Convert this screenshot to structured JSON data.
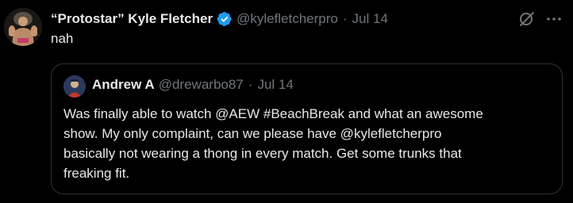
{
  "author": {
    "name": "“Protostar” Kyle Fletcher",
    "handle": "@kylefletcherpro",
    "date": "Jul 14",
    "verified": true
  },
  "separator": "·",
  "tweet": {
    "text": "nah"
  },
  "quote": {
    "name": "Andrew A",
    "handle": "@drewarbo87",
    "date": "Jul 14",
    "lines": [
      "Was finally able to watch @AEW #BeachBreak and what an awesome",
      "show. My only complaint, can we please have @kylefletcherpro",
      "basically not wearing a thong in every match. Get some trunks that",
      "freaking fit."
    ]
  },
  "icons": {
    "grok": "grok-icon",
    "more": "more-icon",
    "verified": "verified-badge-icon"
  },
  "colors": {
    "background": "#000000",
    "text": "#e7e9ea",
    "muted": "#71767b",
    "border": "#2f3336",
    "verified": "#1d9bf0"
  }
}
